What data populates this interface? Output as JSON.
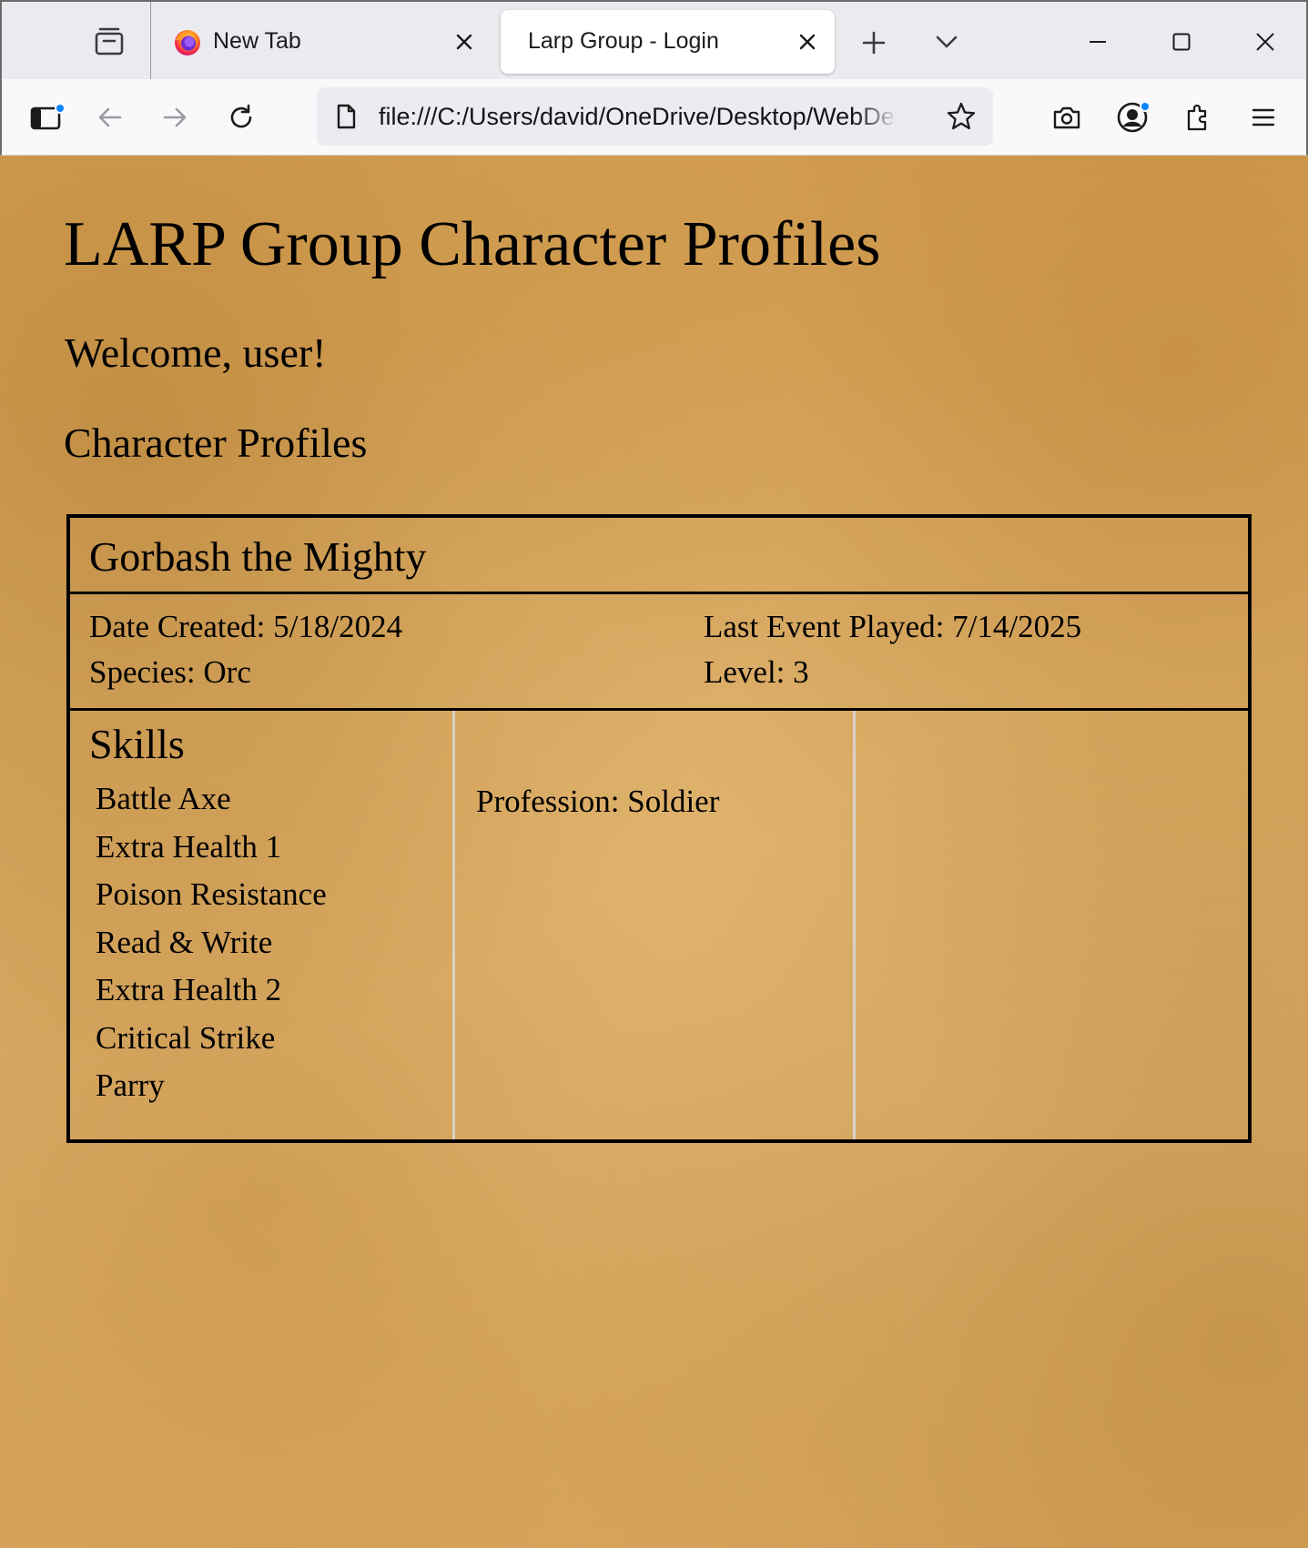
{
  "browser": {
    "tabs": [
      {
        "label": "New Tab",
        "active": false,
        "icon": "firefox-icon"
      },
      {
        "label": "Larp Group - Login",
        "active": true
      }
    ],
    "url": "file:///C:/Users/david/OneDrive/Desktop/WebDesign",
    "accent": "#0a84ff"
  },
  "page": {
    "title": "LARP Group Character Profiles",
    "welcome": "Welcome, user!",
    "section_title": "Character Profiles",
    "characters": [
      {
        "name": "Gorbash the Mighty",
        "date_created": "Date Created: 5/18/2024",
        "species": "Species: Orc",
        "last_event": "Last Event Played: 7/14/2025",
        "level": "Level: 3",
        "skills_title": "Skills",
        "skills": [
          "Battle Axe",
          "Extra Health 1",
          "Poison Resistance",
          "Read & Write",
          "Extra Health 2",
          "Critical Strike",
          "Parry"
        ],
        "profession": "Profession: Soldier"
      }
    ]
  }
}
